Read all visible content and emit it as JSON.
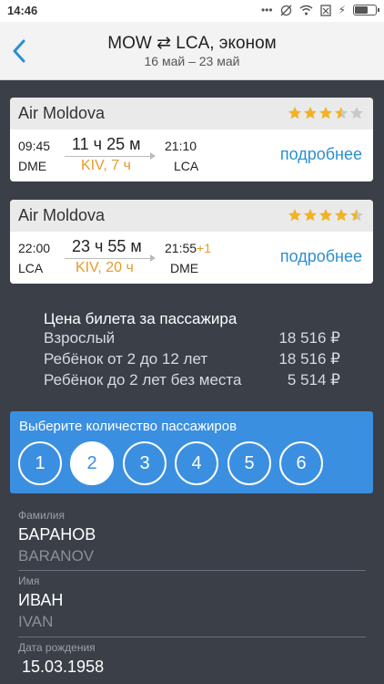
{
  "status_bar": {
    "time": "14:46",
    "icons": [
      "dots-icon",
      "sync-off-icon",
      "wifi-icon",
      "sim-icon",
      "charge-icon"
    ],
    "battery_level": 0.6
  },
  "header": {
    "route": "MOW ⇄ LCA, эконом",
    "dates": "16 май – 23 май",
    "back_icon": "chevron-left-icon"
  },
  "flights": [
    {
      "airline": "Air Moldova",
      "rating": 3.5,
      "depart_time": "09:45",
      "depart_airport": "DME",
      "duration": "11 ч 25 м",
      "via": "KIV, 7 ч",
      "arrive_time": "21:10",
      "arrive_plus": "",
      "arrive_airport": "LCA",
      "details_label": "подробнее"
    },
    {
      "airline": "Air Moldova",
      "rating": 4.5,
      "depart_time": "22:00",
      "depart_airport": "LCA",
      "duration": "23 ч 55 м",
      "via": "KIV, 20 ч",
      "arrive_time": "21:55",
      "arrive_plus": "+1",
      "arrive_airport": "DME",
      "details_label": "подробнее"
    }
  ],
  "prices": {
    "title": "Цена билета за пассажира",
    "rows": [
      {
        "label": "Взрослый",
        "value": "18 516 ₽"
      },
      {
        "label": "Ребёнок от 2 до 12 лет",
        "value": "18 516 ₽"
      },
      {
        "label": "Ребёнок до 2 лет без места",
        "value": "5 514 ₽"
      }
    ]
  },
  "passengers": {
    "label": "Выберите количество пассажиров",
    "options": [
      "1",
      "2",
      "3",
      "4",
      "5",
      "6"
    ],
    "selected": "2"
  },
  "form": {
    "surname": {
      "label": "Фамилия",
      "value": "БАРАНОВ",
      "translit": "BARANOV"
    },
    "name": {
      "label": "Имя",
      "value": "ИВАН",
      "translit": "IVAN"
    },
    "birthdate": {
      "label": "Дата рождения",
      "value": "15.03.1958"
    }
  },
  "colors": {
    "accent": "#3b8fe0",
    "link": "#2d8fd0",
    "transfer": "#e69a2a",
    "star": "#f0b323",
    "background": "#3a3f48"
  }
}
